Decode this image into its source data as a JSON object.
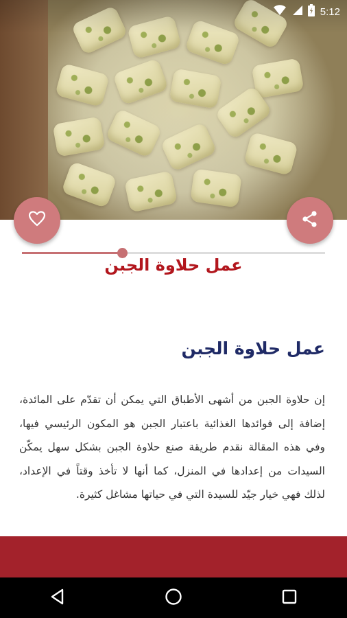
{
  "status_bar": {
    "time": "5:12",
    "icons": [
      "wifi-icon",
      "signal-icon",
      "battery-icon"
    ]
  },
  "hero": {
    "image": "cheese-halawa-dish-photo",
    "favorite_icon": "heart-outline-icon",
    "share_icon": "share-icon"
  },
  "article": {
    "title": "عمل حلاوة الجبن",
    "heading": "عمل حلاوة الجبن",
    "body": "إن حلاوة الجبن من أشهى الأطباق التي يمكن أن تقدّم على المائدة، إضافة إلى فوائدها الغذائية باعتبار الجبن هو المكون الرئيسي فيها، وفي هذه المقالة نقدم طريقة صنع حلاوة الجبن بشكل سهل يمكّن السيدات من إعدادها في المنزل، كما أنها لا تأخذ وقتاً في الإعداد، لذلك فهي خيار جيّد للسيدة التي في حياتها مشاغل كثيرة."
  },
  "progress": {
    "fraction": 0.33
  },
  "nav": {
    "icons": [
      "back-triangle-icon",
      "home-circle-icon",
      "recents-square-icon"
    ]
  },
  "colors": {
    "accent": "#c67073",
    "fab": "#cf7b7d",
    "title": "#b2161d",
    "heading": "#1f2a66",
    "bottom_bar": "#a3222b"
  }
}
